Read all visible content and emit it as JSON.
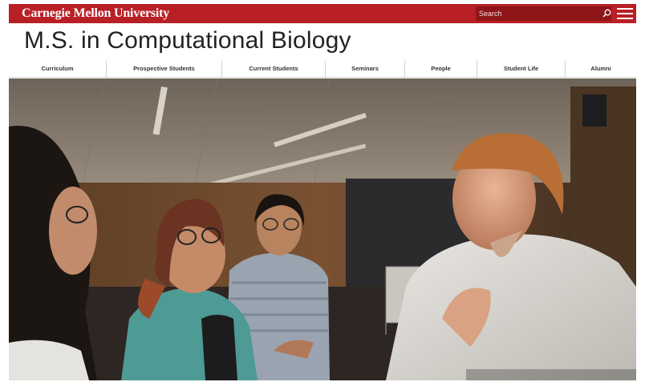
{
  "header": {
    "university_name": "Carnegie Mellon University",
    "search_placeholder": "Search",
    "icons": {
      "search": "search-icon",
      "menu": "menu-icon"
    },
    "brand_color": "#b82025"
  },
  "site": {
    "title": "M.S. in Computational Biology"
  },
  "nav": {
    "items": [
      {
        "label": "Curriculum"
      },
      {
        "label": "Prospective Students"
      },
      {
        "label": "Current Students"
      },
      {
        "label": "Seminars"
      },
      {
        "label": "People"
      },
      {
        "label": "Student Life"
      },
      {
        "label": "Alumni"
      }
    ]
  },
  "hero": {
    "image": "photo of students talking with a man in a white shirt in a lecture hall"
  }
}
